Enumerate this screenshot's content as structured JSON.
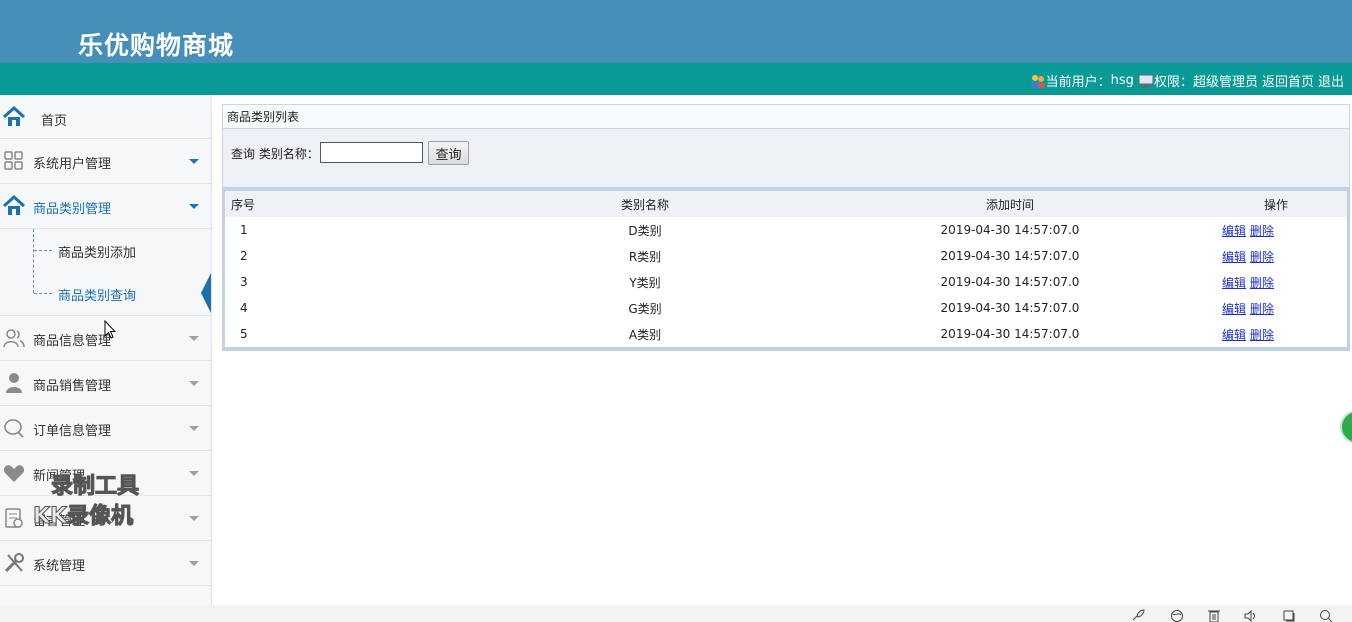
{
  "header": {
    "title": "乐优购物商城"
  },
  "topbar": {
    "current_user_label": "当前用户：",
    "current_user": "hsg",
    "permission_label": "权限：",
    "permission": "超级管理员",
    "back_home": "返回首页",
    "logout": "退出"
  },
  "sidebar": {
    "home": "首页",
    "items": [
      {
        "label": "系统用户管理"
      },
      {
        "label": "商品类别管理"
      },
      {
        "label": "商品信息管理"
      },
      {
        "label": "商品销售管理"
      },
      {
        "label": "订单信息管理"
      },
      {
        "label": "新闻管理"
      },
      {
        "label": "留言管理"
      },
      {
        "label": "系统管理"
      }
    ],
    "sub_items": [
      {
        "label": "商品类别添加"
      },
      {
        "label": "商品类别查询"
      }
    ]
  },
  "panel": {
    "title": "商品类别列表"
  },
  "search": {
    "label": "查询 类别名称：",
    "value": "",
    "button": "查询"
  },
  "table": {
    "headers": [
      "序号",
      "类别名称",
      "添加时间",
      "操作"
    ],
    "edit_label": "编辑",
    "delete_label": "删除",
    "rows": [
      {
        "no": "1",
        "name": "D类别",
        "time": "2019-04-30 14:57:07.0"
      },
      {
        "no": "2",
        "name": "R类别",
        "time": "2019-04-30 14:57:07.0"
      },
      {
        "no": "3",
        "name": "Y类别",
        "time": "2019-04-30 14:57:07.0"
      },
      {
        "no": "4",
        "name": "G类别",
        "time": "2019-04-30 14:57:07.0"
      },
      {
        "no": "5",
        "name": "A类别",
        "time": "2019-04-30 14:57:07.0"
      }
    ]
  },
  "watermark": {
    "line1": "录制工具",
    "line2": "KK录像机"
  },
  "icons": {
    "home": "home-icon",
    "grid": "grid-icon",
    "users": "users-icon",
    "user": "user-icon",
    "chat": "chat-icon",
    "heart": "heart-icon",
    "doc": "doc-icon",
    "tools": "tools-icon"
  },
  "colors": {
    "header": "#458fb8",
    "topbar": "#099a96",
    "accent": "#1d6fb0"
  }
}
